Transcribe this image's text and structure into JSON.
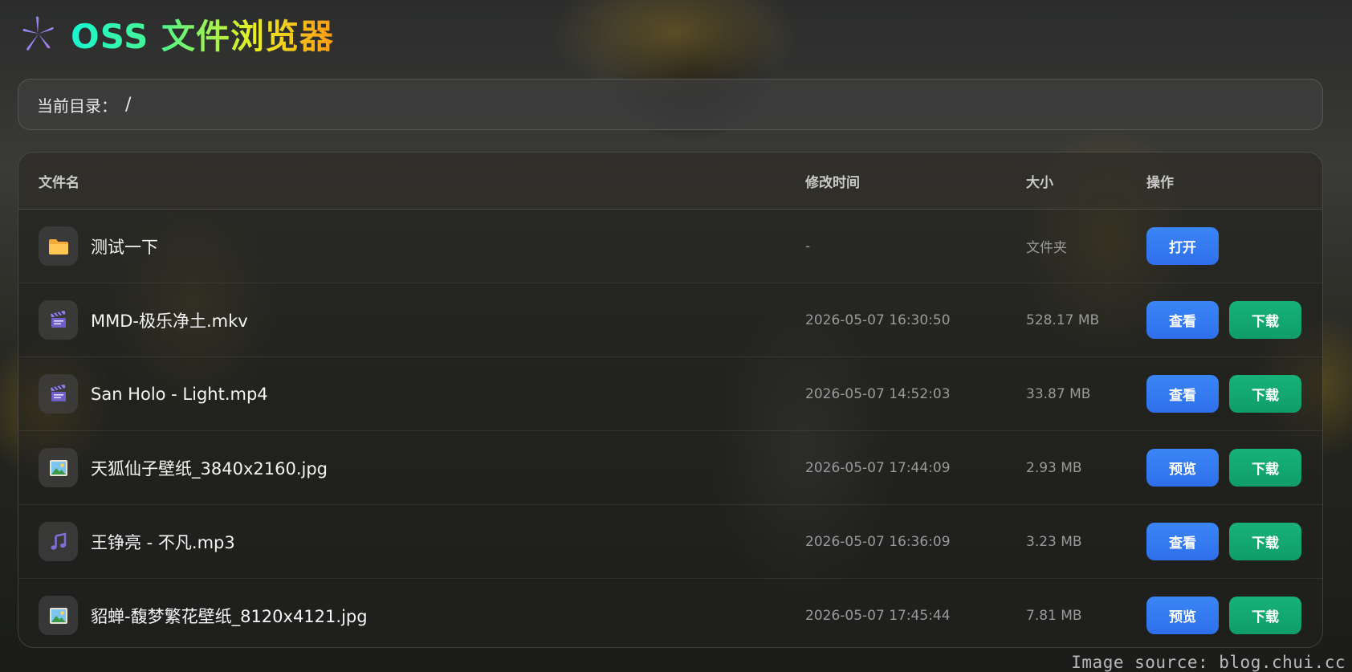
{
  "app": {
    "title": "OSS 文件浏览器",
    "logo_icon": "asterisk-logo-icon"
  },
  "directory": {
    "label": "当前目录：",
    "path": "/"
  },
  "table": {
    "headers": {
      "name": "文件名",
      "time": "修改时间",
      "size": "大小",
      "ops": "操作"
    },
    "rows": [
      {
        "icon": "folder-icon",
        "name": "测试一下",
        "time": "-",
        "size": "文件夹",
        "actions": [
          {
            "label": "打开",
            "color": "#3380f2"
          }
        ]
      },
      {
        "icon": "video-clapper-icon",
        "name": "MMD-极乐净土.mkv",
        "time": "2026-05-07 16:30:50",
        "size": "528.17 MB",
        "actions": [
          {
            "label": "查看",
            "color": "#3380f2"
          },
          {
            "label": "下载",
            "color": "#12a874"
          }
        ]
      },
      {
        "icon": "video-clapper-icon",
        "name": "San Holo - Light.mp4",
        "time": "2026-05-07 14:52:03",
        "size": "33.87 MB",
        "actions": [
          {
            "label": "查看",
            "color": "#3380f2"
          },
          {
            "label": "下载",
            "color": "#12a874"
          }
        ]
      },
      {
        "icon": "image-picture-icon",
        "name": "天狐仙子壁纸_3840x2160.jpg",
        "time": "2026-05-07 17:44:09",
        "size": "2.93 MB",
        "actions": [
          {
            "label": "预览",
            "color": "#3380f2"
          },
          {
            "label": "下载",
            "color": "#12a874"
          }
        ]
      },
      {
        "icon": "music-note-icon",
        "name": "王铮亮 - 不凡.mp3",
        "time": "2026-05-07 16:36:09",
        "size": "3.23 MB",
        "actions": [
          {
            "label": "查看",
            "color": "#3380f2"
          },
          {
            "label": "下载",
            "color": "#12a874"
          }
        ]
      },
      {
        "icon": "image-picture-icon",
        "name": "貂蝉-馥梦繁花壁纸_8120x4121.jpg",
        "time": "2026-05-07 17:45:44",
        "size": "7.81 MB",
        "actions": [
          {
            "label": "预览",
            "color": "#3380f2"
          },
          {
            "label": "下载",
            "color": "#12a874"
          }
        ]
      }
    ]
  },
  "watermark": "Image source: blog.chui.cc"
}
